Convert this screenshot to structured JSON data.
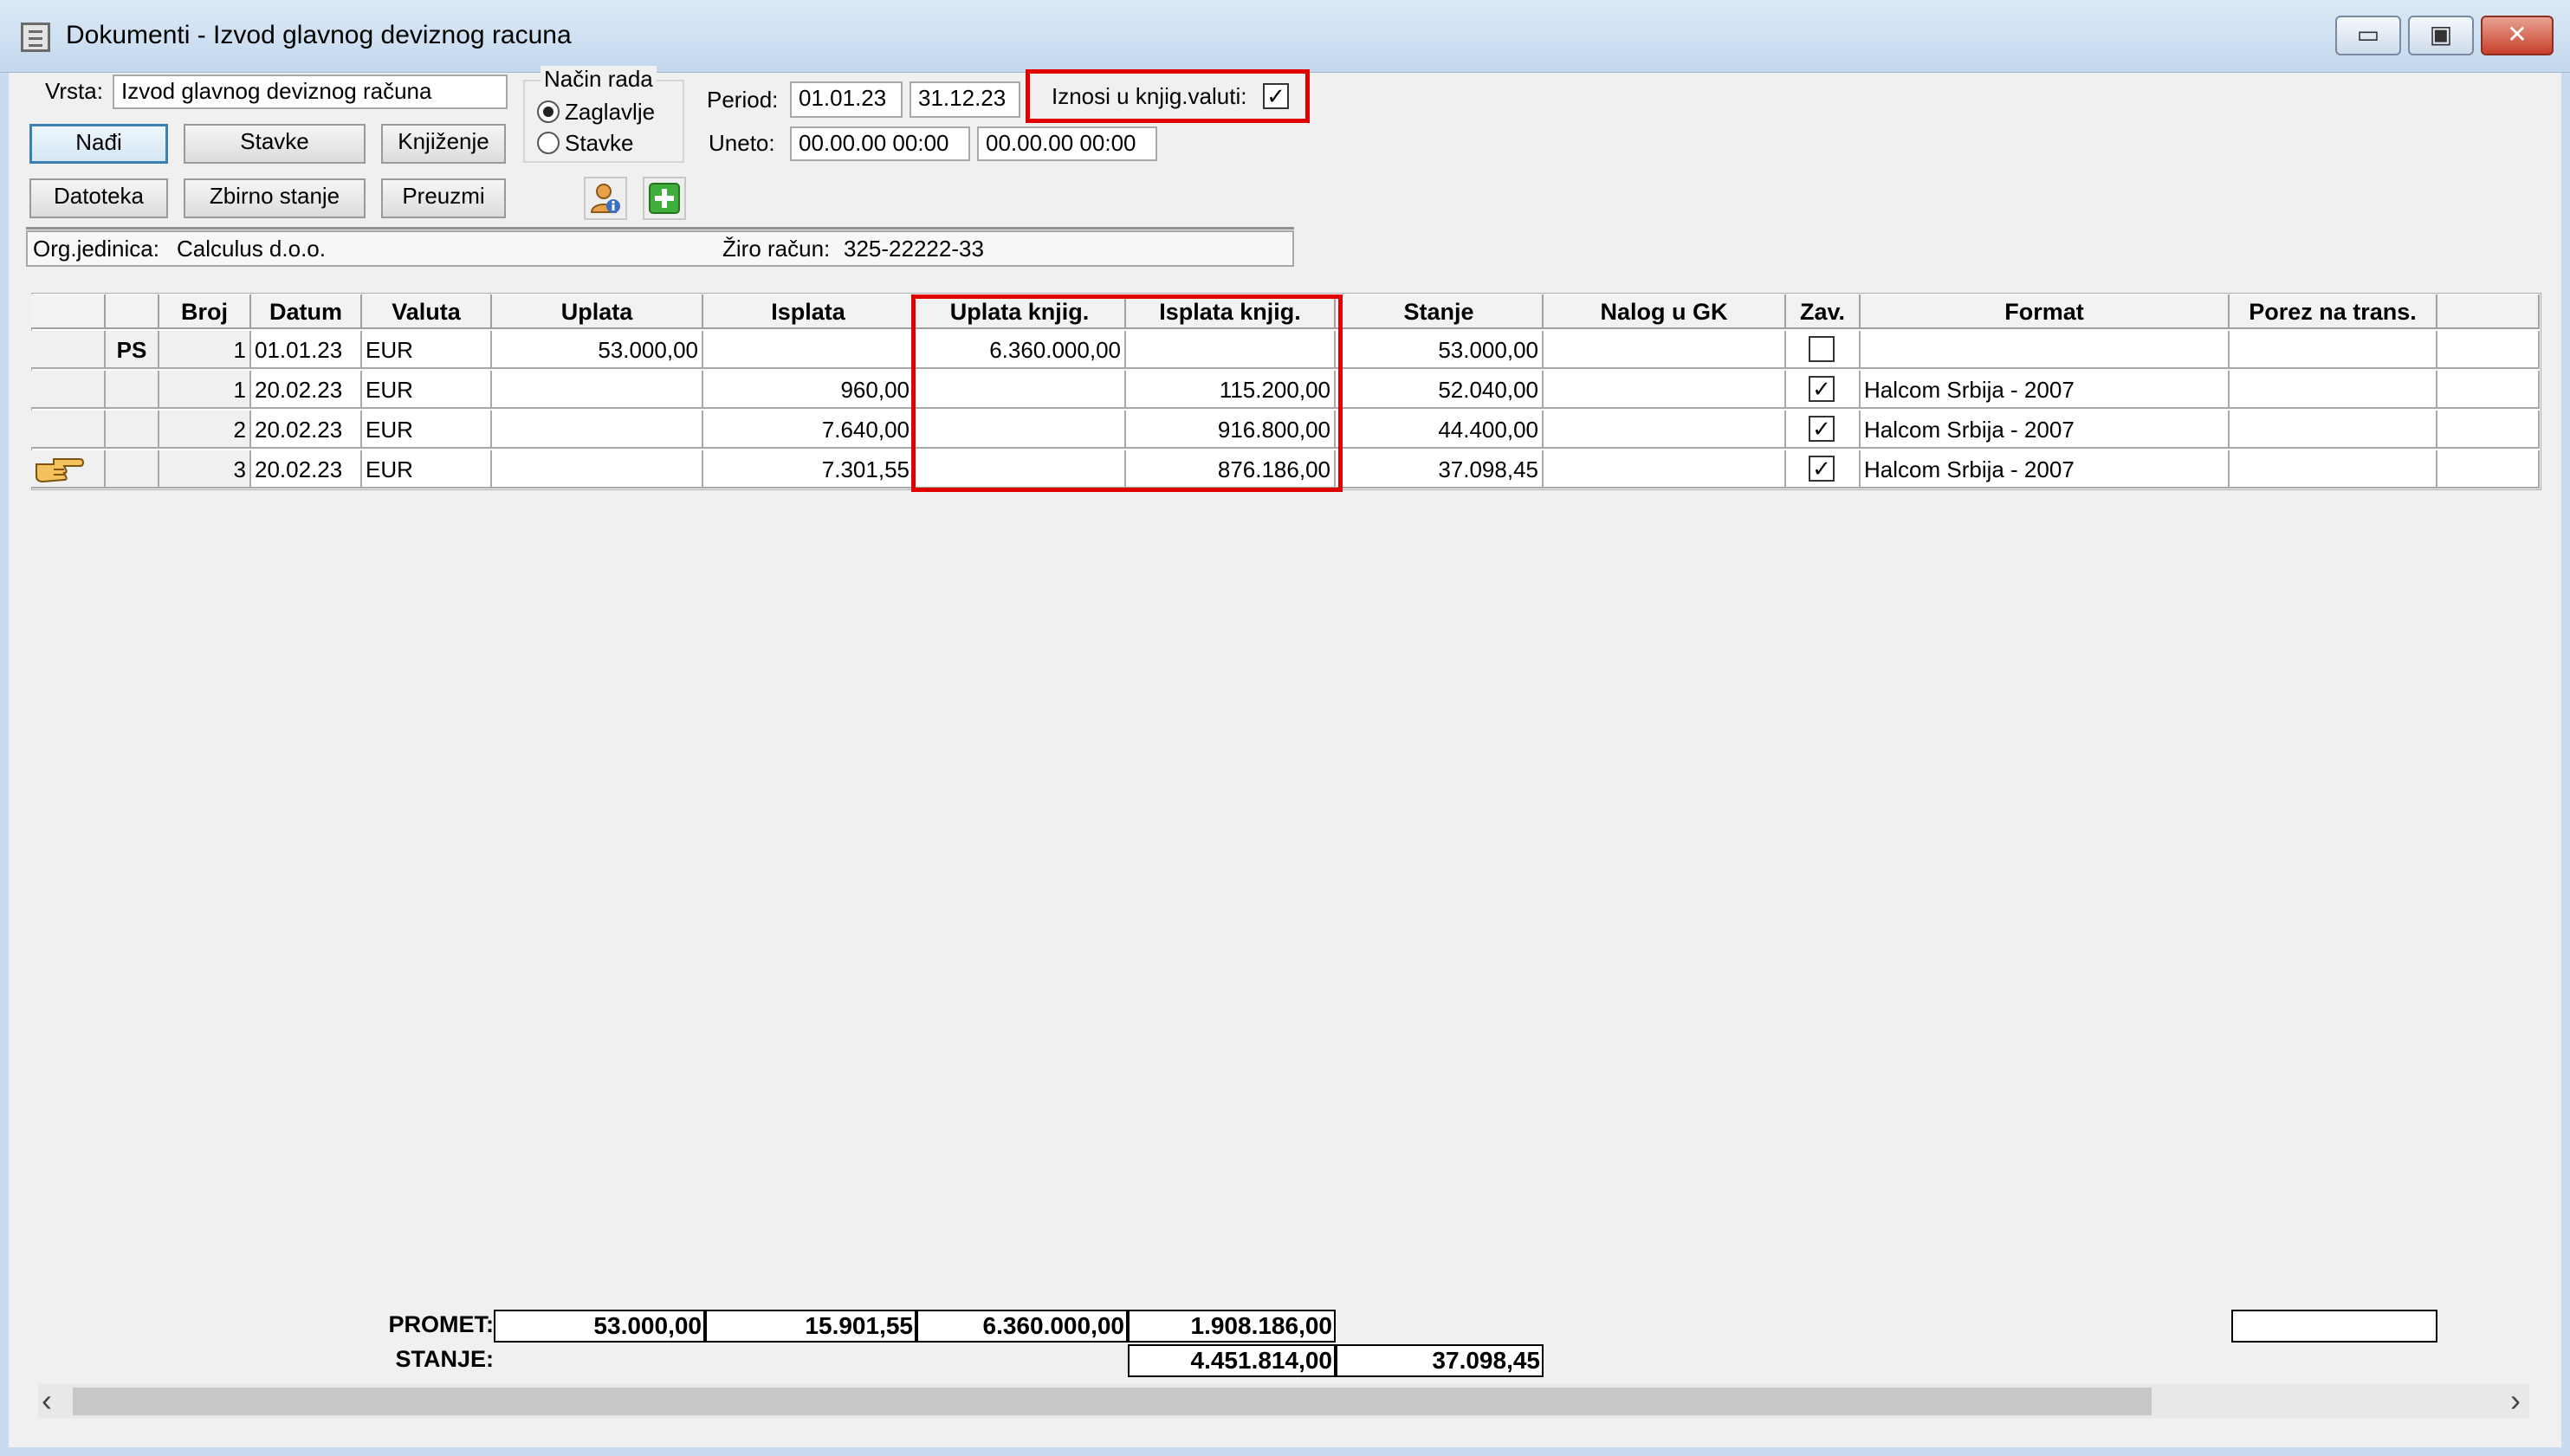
{
  "window": {
    "title": "Dokumenti - Izvod glavnog deviznog racuna",
    "minimize": "▭",
    "maximize": "▣",
    "close": "✕"
  },
  "form": {
    "vrsta_label": "Vrsta:",
    "vrsta_value": "Izvod glavnog deviznog računa",
    "nacin_rada_label": "Način rada",
    "mode_header": "Zaglavlje",
    "mode_items": "Stavke",
    "mode_selected": "Zaglavlje",
    "period_label": "Period:",
    "period_from": "01.01.23",
    "period_to": "31.12.23",
    "uneto_label": "Uneto:",
    "uneto_from": "00.00.00 00:00",
    "uneto_to": "00.00.00 00:00",
    "iznosi_label": "Iznosi u knjig.valuti:",
    "iznosi_checked": "✓"
  },
  "buttons": {
    "nadji": "Nađi",
    "stavke": "Stavke",
    "knjizenje": "Knjiženje",
    "datoteka": "Datoteka",
    "zbirno": "Zbirno stanje",
    "preuzmi": "Preuzmi"
  },
  "icons": {
    "user_info": "user-info-icon",
    "add": "add-icon"
  },
  "info": {
    "org_label": "Org.jedinica:",
    "org_value": "Calculus d.o.o.",
    "ziro_label": "Žiro račun:",
    "ziro_value": "325-22222-33"
  },
  "table": {
    "columns": [
      "Broj",
      "Datum",
      "Valuta",
      "Uplata",
      "Isplata",
      "Uplata knjig.",
      "Isplata knjig.",
      "Stanje",
      "Nalog u GK",
      "Zav.",
      "Format",
      "Porez na trans."
    ],
    "rows": [
      {
        "mark": "PS",
        "broj": "1",
        "datum": "01.01.23",
        "valuta": "EUR",
        "uplata": "53.000,00",
        "isplata": "",
        "uplata_knjig": "6.360.000,00",
        "isplata_knjig": "",
        "stanje": "53.000,00",
        "nalog": "",
        "zav": "",
        "format": "",
        "porez": ""
      },
      {
        "mark": "",
        "broj": "1",
        "datum": "20.02.23",
        "valuta": "EUR",
        "uplata": "",
        "isplata": "960,00",
        "uplata_knjig": "",
        "isplata_knjig": "115.200,00",
        "stanje": "52.040,00",
        "nalog": "",
        "zav": "✓",
        "format": "Halcom Srbija - 2007",
        "porez": ""
      },
      {
        "mark": "",
        "broj": "2",
        "datum": "20.02.23",
        "valuta": "EUR",
        "uplata": "",
        "isplata": "7.640,00",
        "uplata_knjig": "",
        "isplata_knjig": "916.800,00",
        "stanje": "44.400,00",
        "nalog": "",
        "zav": "✓",
        "format": "Halcom Srbija - 2007",
        "porez": ""
      },
      {
        "mark": "",
        "broj": "3",
        "datum": "20.02.23",
        "valuta": "EUR",
        "uplata": "",
        "isplata": "7.301,55",
        "uplata_knjig": "",
        "isplata_knjig": "876.186,00",
        "stanje": "37.098,45",
        "nalog": "",
        "zav": "✓",
        "format": "Halcom Srbija - 2007",
        "porez": ""
      }
    ],
    "current_row_icon": "pointing-hand-icon"
  },
  "totals": {
    "promet_label": "PROMET:",
    "promet_uplata": "53.000,00",
    "promet_isplata": "15.901,55",
    "promet_uplata_knjig": "6.360.000,00",
    "promet_isplata_knjig": "1.908.186,00",
    "stanje_label": "STANJE:",
    "stanje_knjig": "4.451.814,00",
    "stanje_value": "37.098,45"
  },
  "scrollbar": {
    "left_arrow": "‹",
    "right_arrow": "›"
  }
}
